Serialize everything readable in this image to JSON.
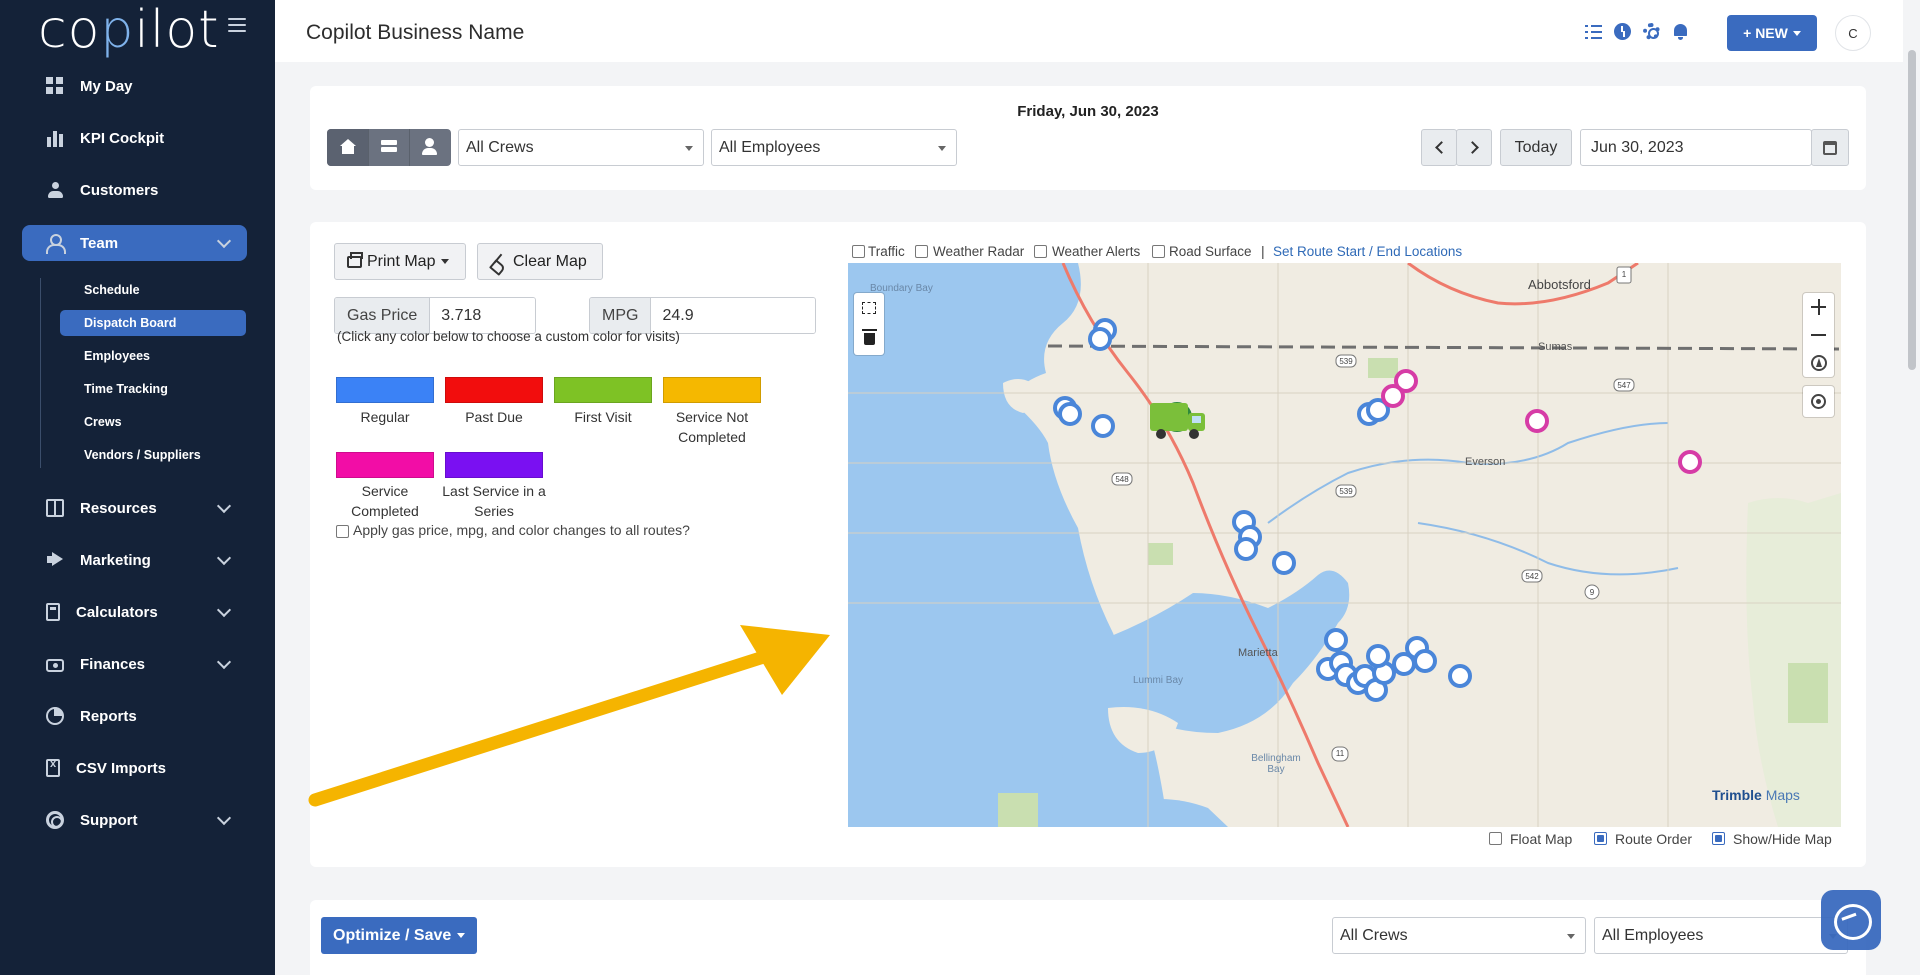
{
  "app": {
    "logo_text": "copilot",
    "business_name": "Copilot Business Name"
  },
  "sidebar": {
    "items": [
      {
        "label": "My Day",
        "icon": "grid-icon"
      },
      {
        "label": "KPI Cockpit",
        "icon": "bar-chart-icon"
      },
      {
        "label": "Customers",
        "icon": "users-icon"
      },
      {
        "label": "Team",
        "icon": "team-icon",
        "expanded": true
      },
      {
        "label": "Resources",
        "icon": "book-icon"
      },
      {
        "label": "Marketing",
        "icon": "megaphone-icon"
      },
      {
        "label": "Calculators",
        "icon": "calculator-icon"
      },
      {
        "label": "Finances",
        "icon": "money-icon"
      },
      {
        "label": "Reports",
        "icon": "pie-chart-icon"
      },
      {
        "label": "CSV Imports",
        "icon": "file-csv-icon"
      },
      {
        "label": "Support",
        "icon": "life-ring-icon"
      }
    ],
    "team_sub": [
      "Schedule",
      "Dispatch Board",
      "Employees",
      "Time Tracking",
      "Crews",
      "Vendors / Suppliers"
    ],
    "active_sub": "Dispatch Board"
  },
  "header": {
    "new_label": "+ NEW",
    "avatar_letter": "C"
  },
  "filters": {
    "date_title": "Friday, Jun 30, 2023",
    "crews": "All Crews",
    "employees": "All Employees",
    "today_label": "Today",
    "date_value": "Jun 30, 2023"
  },
  "map_panel": {
    "print_label": "Print Map",
    "clear_label": "Clear Map",
    "gas_label": "Gas Price",
    "gas_value": "3.718",
    "mpg_label": "MPG",
    "mpg_value": "24.9",
    "hint": "(Click any color below to choose a custom color for visits)",
    "legend": [
      {
        "label": "Regular",
        "color": "#3b82f6"
      },
      {
        "label": "Past Due",
        "color": "#f20d0d"
      },
      {
        "label": "First Visit",
        "color": "#7ec225"
      },
      {
        "label": "Service Not Completed",
        "color": "#f5b800"
      },
      {
        "label": "Service Completed",
        "color": "#f20da6"
      },
      {
        "label": "Last Service in a Series",
        "color": "#7a10f2"
      }
    ],
    "apply_all": "Apply gas price, mpg, and color changes to all routes?"
  },
  "map_toggles": {
    "traffic": "Traffic",
    "radar": "Weather Radar",
    "alerts": "Weather Alerts",
    "road": "Road Surface",
    "sep": "|",
    "route_link": "Set Route Start / End Locations"
  },
  "map_labels": {
    "abbotsford": "Abbotsford",
    "boundary_bay": "Boundary Bay",
    "sumas": "Sumas",
    "everson": "Everson",
    "marietta": "Marietta",
    "lummi_bay": "Lummi Bay",
    "bellingham_bay": "Bellingham Bay",
    "shields": [
      "539",
      "548",
      "539",
      "547",
      "542",
      "9",
      "11",
      "1"
    ],
    "brand": "Trimble",
    "brand_suffix": "Maps"
  },
  "map_options": {
    "float": "Float Map",
    "route_order": "Route Order",
    "show_hide": "Show/Hide Map"
  },
  "bottom": {
    "optimize_label": "Optimize / Save",
    "crews": "All Crews",
    "employees": "All Employees"
  }
}
